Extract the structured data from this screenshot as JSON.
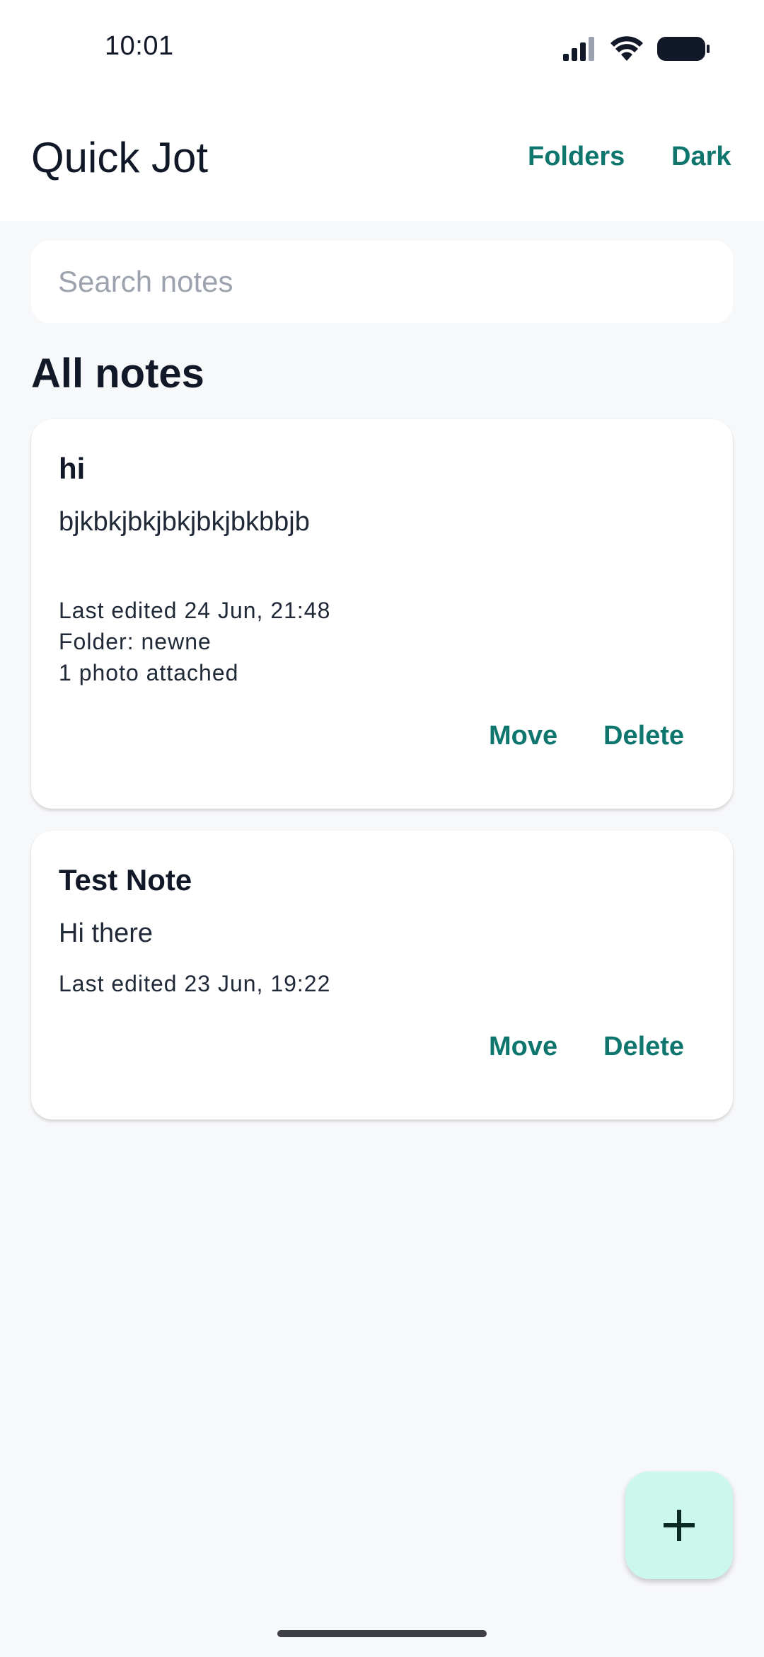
{
  "status_bar": {
    "time": "10:01",
    "icons": [
      "signal-icon",
      "wifi-icon",
      "battery-icon"
    ]
  },
  "header": {
    "title": "Quick Jot",
    "folders_label": "Folders",
    "theme_label": "Dark"
  },
  "search": {
    "placeholder": "Search notes",
    "value": ""
  },
  "section": {
    "title": "All notes"
  },
  "notes": [
    {
      "title": "hi",
      "body": "bjkbkjbkjbkjbkjbkbbjb",
      "last_edited": "Last edited 24 Jun, 21:48",
      "folder": "Folder: newne",
      "attachments": "1 photo attached",
      "move_label": "Move",
      "delete_label": "Delete"
    },
    {
      "title": "Test Note",
      "body": "Hi there",
      "last_edited": "Last edited 23 Jun, 19:22",
      "move_label": "Move",
      "delete_label": "Delete"
    }
  ],
  "fab": {
    "icon": "plus-icon"
  },
  "colors": {
    "accent": "#0f766e",
    "fab_background": "#ccf7ec",
    "page_background": "#f7f8fa"
  }
}
